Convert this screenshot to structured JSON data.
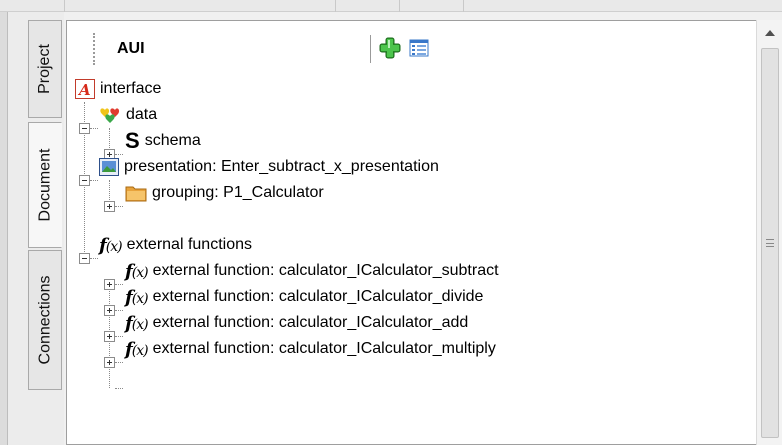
{
  "tabs": [
    {
      "label": "Project",
      "active": false
    },
    {
      "label": "Document",
      "active": true
    },
    {
      "label": "Connections",
      "active": false
    }
  ],
  "header": {
    "title": "AUI"
  },
  "tree": {
    "root": {
      "label": "interface",
      "icon": "aui-logo-icon"
    },
    "data": {
      "label": "data",
      "icon": "data-hearts-icon",
      "expanded": true
    },
    "schema": {
      "label": "schema",
      "icon_glyph": "S",
      "expanded": false
    },
    "presentation": {
      "label": "presentation: Enter_subtract_x_presentation",
      "icon": "presentation-icon",
      "expanded": true
    },
    "grouping": {
      "label": "grouping: P1_Calculator",
      "icon": "folder-icon",
      "expanded": false
    },
    "external_functions": {
      "label": "external functions",
      "icon": "function-icon",
      "expanded": true
    },
    "functions": [
      {
        "label": "external function: calculator_ICalculator_subtract"
      },
      {
        "label": "external function: calculator_ICalculator_divide"
      },
      {
        "label": "external function: calculator_ICalculator_add"
      },
      {
        "label": "external function: calculator_ICalculator_multiply"
      }
    ],
    "fx_glyph": "f",
    "fx_args": "(x)"
  },
  "colors": {
    "folder": "#e8a33c",
    "add_green": "#2f9e2f",
    "hearts": [
      "#e03a2e",
      "#f0c419",
      "#3aa84a"
    ]
  }
}
